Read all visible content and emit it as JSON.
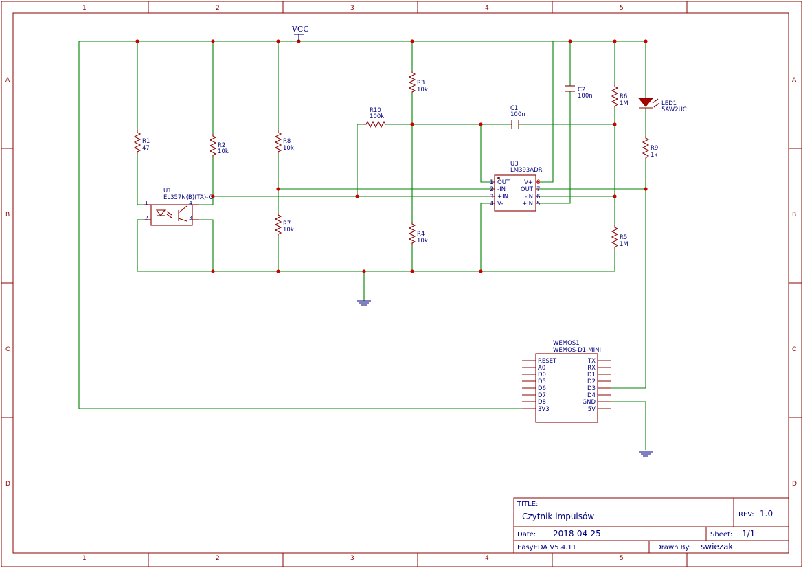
{
  "frame": {
    "cols": [
      "1",
      "2",
      "3",
      "4",
      "5"
    ],
    "rows": [
      "A",
      "B",
      "C",
      "D"
    ]
  },
  "power": {
    "vcc": "VCC"
  },
  "parts": {
    "r1": {
      "ref": "R1",
      "val": "47"
    },
    "r2": {
      "ref": "R2",
      "val": "10k"
    },
    "r3": {
      "ref": "R3",
      "val": "10k"
    },
    "r4": {
      "ref": "R4",
      "val": "10k"
    },
    "r5": {
      "ref": "R5",
      "val": "1M"
    },
    "r6": {
      "ref": "R6",
      "val": "1M"
    },
    "r7": {
      "ref": "R7",
      "val": "10k"
    },
    "r8": {
      "ref": "R8",
      "val": "10k"
    },
    "r9": {
      "ref": "R9",
      "val": "1k"
    },
    "r10": {
      "ref": "R10",
      "val": "100k"
    },
    "c1": {
      "ref": "C1",
      "val": "100n"
    },
    "c2": {
      "ref": "C2",
      "val": "100n"
    },
    "led1": {
      "ref": "LED1",
      "val": "5AW2UC"
    },
    "u1": {
      "ref": "U1",
      "val": "EL357N(B)(TA)-G",
      "pins": [
        "1",
        "2",
        "3",
        "4"
      ]
    },
    "u3": {
      "ref": "U3",
      "val": "LM393ADR",
      "left_pins": [
        {
          "num": "1",
          "name": "OUT"
        },
        {
          "num": "2",
          "name": "-IN"
        },
        {
          "num": "3",
          "name": "+IN"
        },
        {
          "num": "4",
          "name": "V-"
        }
      ],
      "right_pins": [
        {
          "num": "8",
          "name": "V+"
        },
        {
          "num": "7",
          "name": "OUT"
        },
        {
          "num": "6",
          "name": "-IN"
        },
        {
          "num": "5",
          "name": "+IN"
        }
      ]
    },
    "wemos": {
      "ref": "WEMOS1",
      "val": "WEMOS-D1-MINI",
      "left_pins": [
        "RESET",
        "A0",
        "D0",
        "D5",
        "D6",
        "D7",
        "D8",
        "3V3"
      ],
      "right_pins": [
        "TX",
        "RX",
        "D1",
        "D2",
        "D3",
        "D4",
        "GND",
        "5V"
      ]
    }
  },
  "title_block": {
    "title_label": "TITLE:",
    "title": "Czytnik impulsów",
    "rev_label": "REV:",
    "rev": "1.0",
    "date_label": "Date:",
    "date": "2018-04-25",
    "sheet_label": "Sheet:",
    "sheet": "1/1",
    "tool": "EasyEDA V5.4.11",
    "drawn_label": "Drawn By:",
    "drawn": "swiezak"
  }
}
